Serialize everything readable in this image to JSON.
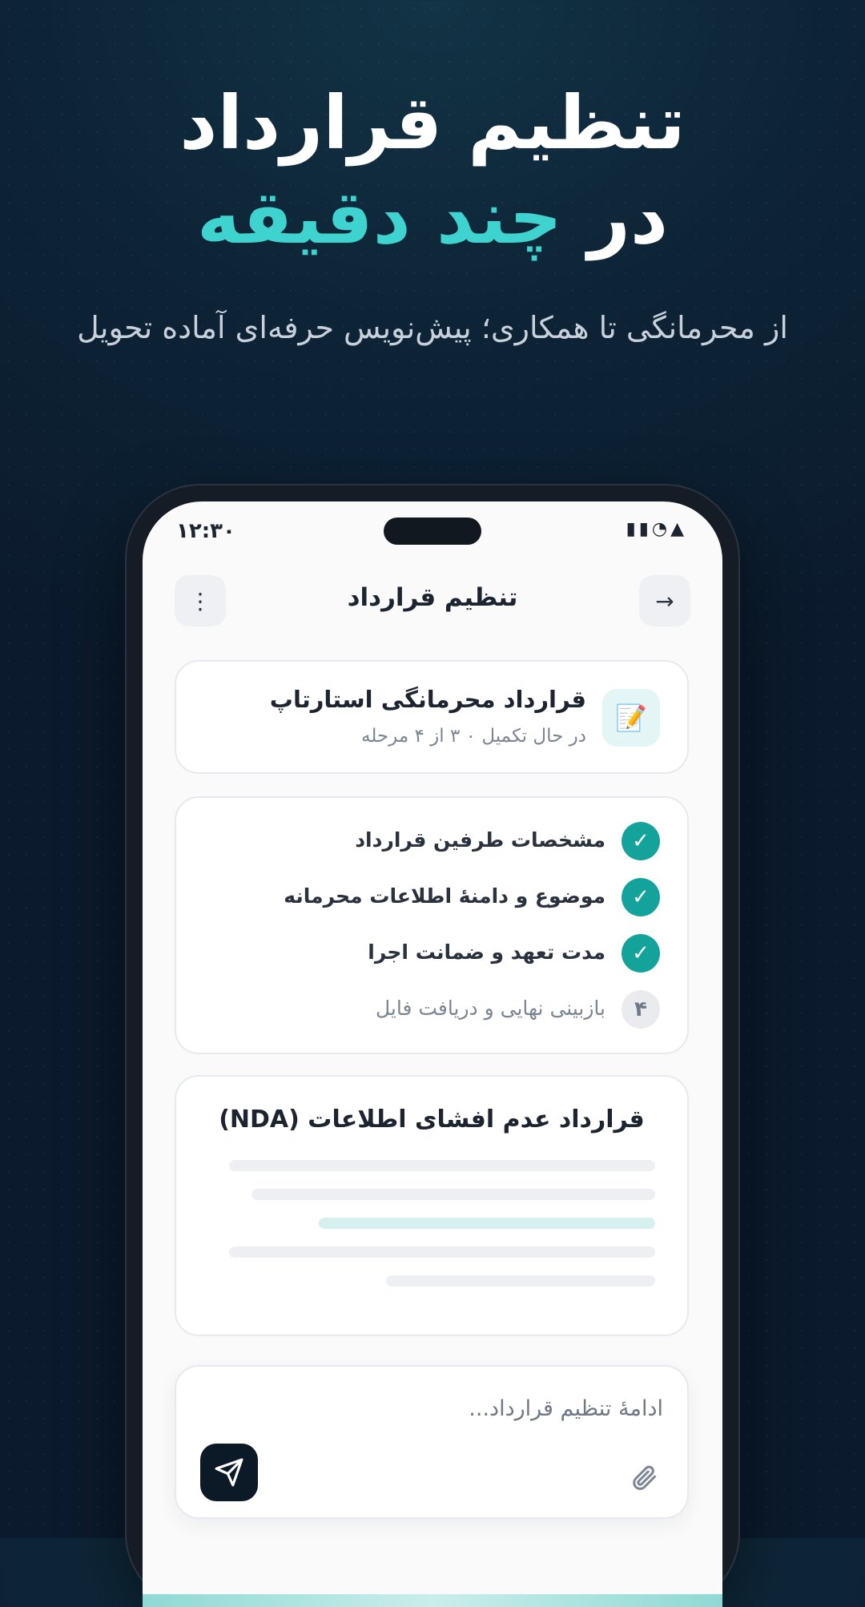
{
  "hero": {
    "title_line1": "تنظیم قرارداد",
    "title_line2_prefix": "در",
    "title_line2_accent": "چند دقیقه",
    "subtitle": "از محرمانگی تا همکاری؛ پیش‌نویس حرفه‌ای آماده تحویل"
  },
  "status_bar": {
    "time": "۱۲:۳۰"
  },
  "header": {
    "title": "تنظیم قرارداد"
  },
  "contract": {
    "title": "قرارداد محرمانگی استارتاپ",
    "status": "در حال تکمیل ۰ ۳ از ۴ مرحله"
  },
  "steps": [
    {
      "label": "مشخصات طرفین قرارداد",
      "done": true,
      "badge": "✓"
    },
    {
      "label": "موضوع و دامنهٔ اطلاعات محرمانه",
      "done": true,
      "badge": "✓"
    },
    {
      "label": "مدت تعهد و ضمانت اجرا",
      "done": true,
      "badge": "✓"
    },
    {
      "label": "بازبینی نهایی و دریافت فایل",
      "done": false,
      "badge": "۴"
    }
  ],
  "preview": {
    "title": "قرارداد عدم افشای اطلاعات (NDA)"
  },
  "composer": {
    "placeholder": "ادامهٔ تنظیم قرارداد..."
  },
  "colors": {
    "accent": "#3fd3cf",
    "step_done": "#14a39b",
    "send_button": "#0c1a28"
  }
}
